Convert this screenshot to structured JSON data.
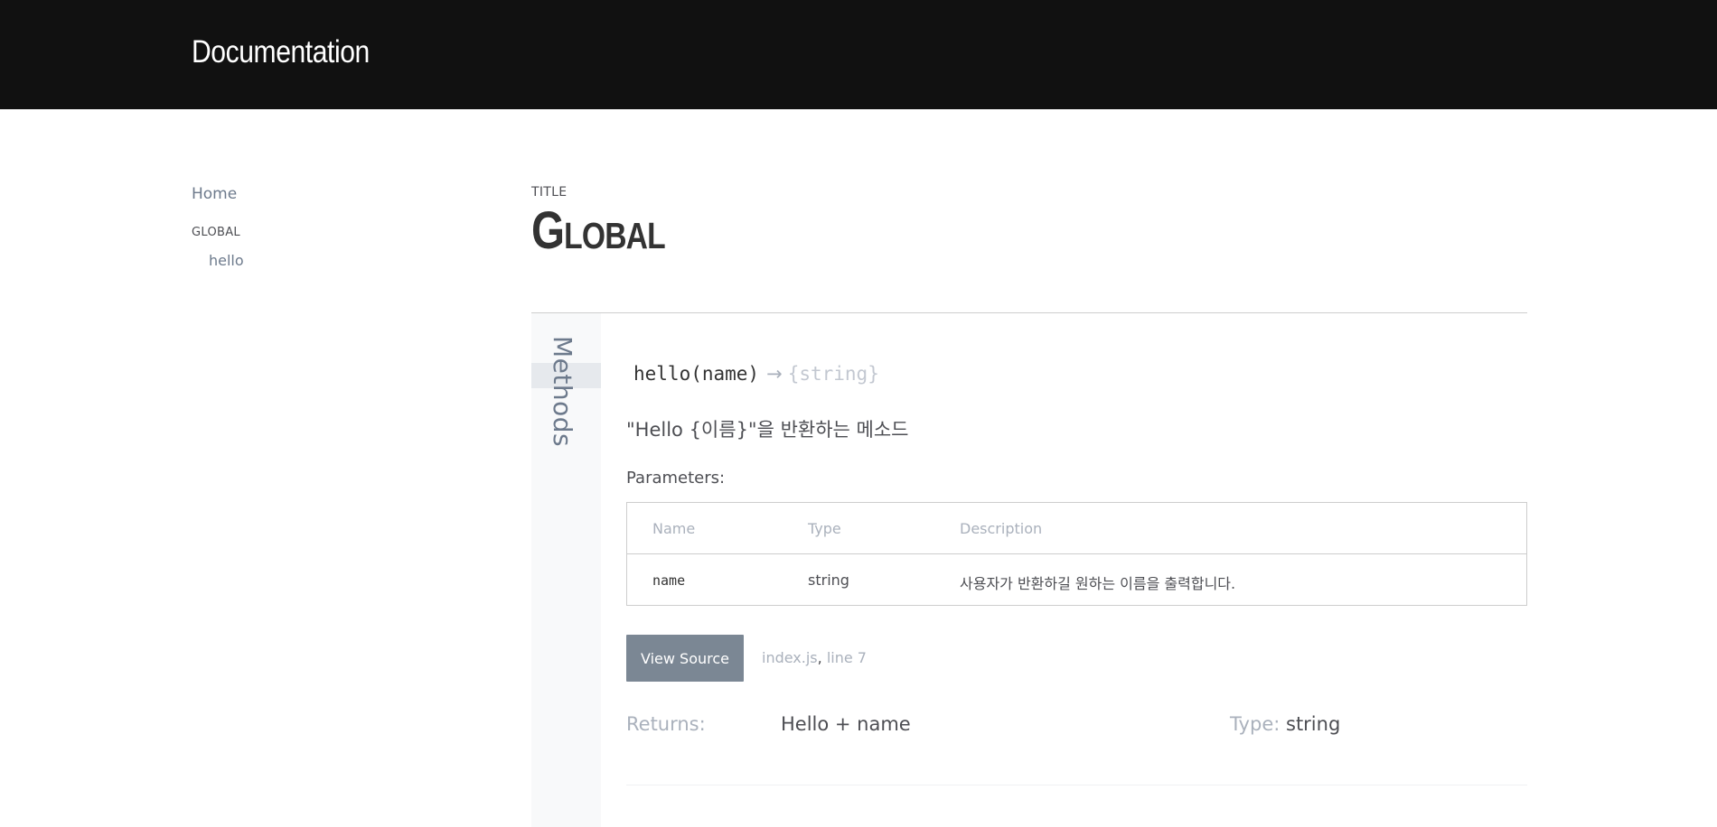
{
  "header": {
    "brand": "Documentation"
  },
  "sidebar": {
    "home_label": "Home",
    "section_heading": "GLOBAL",
    "items": [
      {
        "label": "hello"
      }
    ]
  },
  "page": {
    "kicker": "TITLE",
    "title": "Global"
  },
  "methods": {
    "section_label": "Methods",
    "signature": {
      "name": "hello(name)",
      "arrow": "→",
      "returns": "{string}"
    },
    "description": "\"Hello {이름}\"을 반환하는 메소드",
    "parameters_title": "Parameters:",
    "table": {
      "headers": [
        "Name",
        "Type",
        "Description"
      ],
      "rows": [
        {
          "name": "name",
          "type": "string",
          "description": "사용자가 반환하길 원하는 이름을 출력합니다."
        }
      ]
    },
    "view_source_label": "View Source",
    "source_file": "index.js",
    "source_separator": ",",
    "source_line": "line 7",
    "returns_label": "Returns:",
    "returns_value": "Hello + name",
    "type_label": "Type:",
    "type_value": "string"
  },
  "colors": {
    "header_bg": "#111111",
    "link": "#6d7a8c",
    "button_bg": "#7b8794",
    "muted": "#aab1bc"
  }
}
